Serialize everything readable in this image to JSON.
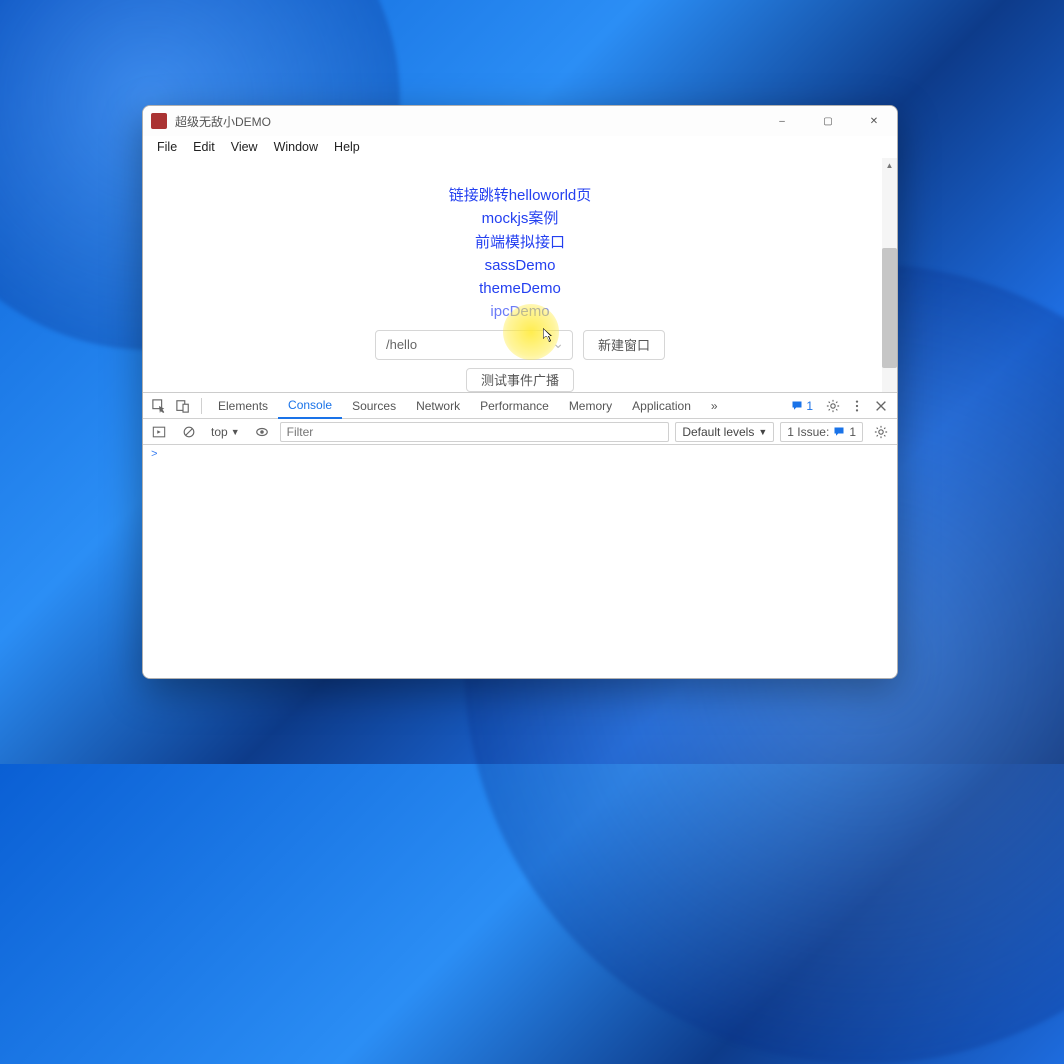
{
  "window": {
    "title": "超级无敌小DEMO",
    "controls": {
      "min": "–",
      "max": "▢",
      "close": "✕"
    }
  },
  "menubar": [
    "File",
    "Edit",
    "View",
    "Window",
    "Help"
  ],
  "links": [
    "链接跳转helloworld页",
    "mockjs案例",
    "前端模拟接口",
    "sassDemo",
    "themeDemo",
    "ipcDemo"
  ],
  "select_value": "/hello",
  "buttons": {
    "new_window": "新建窗口",
    "broadcast": "测试事件广播"
  },
  "devtools": {
    "tabs": [
      "Elements",
      "Console",
      "Sources",
      "Network",
      "Performance",
      "Memory",
      "Application"
    ],
    "active_tab": "Console",
    "more_glyph": "»",
    "msg_count": "1",
    "filter": {
      "context": "top",
      "placeholder": "Filter",
      "levels": "Default levels",
      "issues_label": "1 Issue:",
      "issues_count": "1"
    },
    "prompt": ">"
  }
}
